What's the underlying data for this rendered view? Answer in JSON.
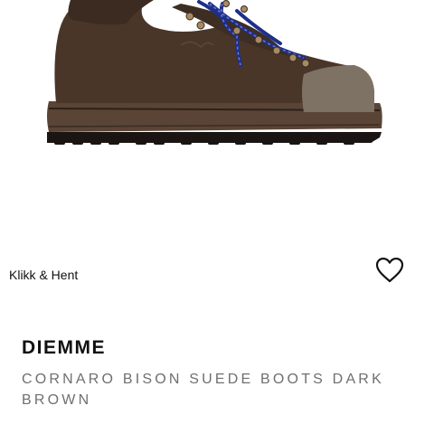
{
  "product": {
    "image_alt": "shoe-photo",
    "pickup_label": "Klikk & Hent",
    "wishlist_icon": "heart-outline-icon",
    "brand": "DIEMME",
    "title": "CORNARO BISON SUEDE BOOTS DARK BROWN"
  },
  "colors": {
    "suede": "#4a3629",
    "sole": "#5a4436",
    "lace": "#1e2f8a",
    "text": "#111111",
    "subtext": "#6f6f6f"
  }
}
